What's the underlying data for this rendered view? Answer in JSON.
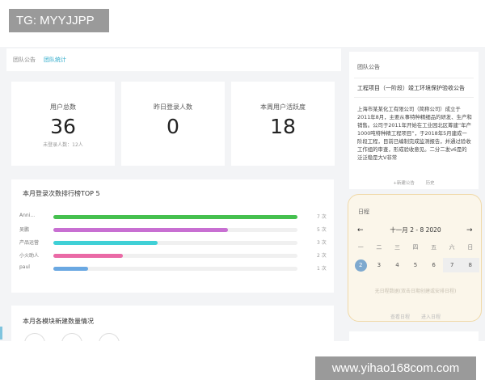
{
  "watermark_tag": "TG: MYYJJPP",
  "watermark_site": "www.yihao168com.com",
  "tabs": [
    "团队公告",
    "团队统计"
  ],
  "stats": [
    {
      "label": "用户总数",
      "value": "36",
      "sub": "未登录人数：12人"
    },
    {
      "label": "昨日登录人数",
      "value": "0",
      "sub": ""
    },
    {
      "label": "本周用户活跃度",
      "value": "18",
      "sub": ""
    }
  ],
  "ranking": {
    "title": "本月登录次数排行榜TOP 5",
    "max_value": 7,
    "items": [
      {
        "name": "Anni...",
        "count_label": "7 次",
        "value": 7,
        "color": "#45c04f"
      },
      {
        "name": "吴鹏",
        "count_label": "5 次",
        "value": 5,
        "color": "#c86fd2"
      },
      {
        "name": "产品运营",
        "count_label": "3 次",
        "value": 3,
        "color": "#3fd0d6"
      },
      {
        "name": "小火助人",
        "count_label": "2 次",
        "value": 2,
        "color": "#ea6aa6"
      },
      {
        "name": "paul",
        "count_label": "1 次",
        "value": 1,
        "color": "#6aa8e2"
      }
    ]
  },
  "modules": {
    "title": "本月各模块新建数量情况"
  },
  "notice": {
    "header": "团队公告",
    "title": "工程项目（一阶段）竣工环境保护验收公告",
    "body": "上海市某某化工有限公司（简称公司）成立于2011年8月，主要从事特种精细品的研发、生产和销售。公司于2011年开始在工业园北区筹建“年产1000吨特种精工程项目”，于2018年5月建成一阶段工程，目前已编制完成监测报告，并通过验收工作组的审查，形成验收意见。二分二发v6是的泛泛稳是大V非常",
    "actions": [
      "+新建公告",
      "历史"
    ]
  },
  "calendar": {
    "header": "日程",
    "month_label": "十一月 2 - 8  2020",
    "prev_icon": "arrow-left",
    "next_icon": "arrow-right",
    "weekdays": [
      "一",
      "二",
      "三",
      "四",
      "五",
      "六",
      "日"
    ],
    "days": [
      {
        "label": "2",
        "selected": true,
        "weekend": false
      },
      {
        "label": "3",
        "selected": false,
        "weekend": false
      },
      {
        "label": "4",
        "selected": false,
        "weekend": false
      },
      {
        "label": "5",
        "selected": false,
        "weekend": false
      },
      {
        "label": "6",
        "selected": false,
        "weekend": false
      },
      {
        "label": "7",
        "selected": false,
        "weekend": true
      },
      {
        "label": "8",
        "selected": false,
        "weekend": true
      }
    ],
    "empty_text": "无日程数据(双击日期创建或安排日程)",
    "actions": [
      "查看日程",
      "进入日程"
    ]
  }
}
